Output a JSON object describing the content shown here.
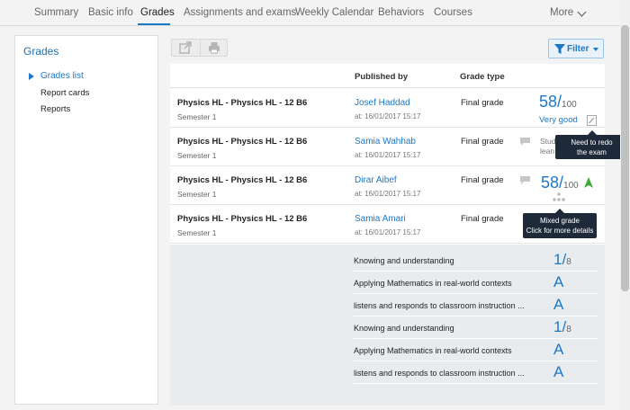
{
  "nav": {
    "tabs": [
      {
        "label": "Summary"
      },
      {
        "label": "Basic info"
      },
      {
        "label": "Grades"
      },
      {
        "label": "Assignments and exams"
      },
      {
        "label": "Weekly Calendar"
      },
      {
        "label": "Behaviors"
      },
      {
        "label": "Courses"
      }
    ],
    "more_label": "More"
  },
  "sidebar": {
    "title": "Grades",
    "items": [
      {
        "label": "Grades list"
      },
      {
        "label": "Report cards"
      },
      {
        "label": "Reports"
      }
    ]
  },
  "toolbar": {
    "filter_label": "Filter",
    "export_icon": "export-icon",
    "print_icon": "print-icon"
  },
  "table": {
    "headers": {
      "published_by": "Published by",
      "grade_type": "Grade type"
    },
    "rows": [
      {
        "course": "Physics HL - Physics HL - 12 B6",
        "semester": "Semester 1",
        "teacher": "Josef Haddad",
        "published": "at: 16/01/2017 15:17",
        "grade_type": "Final grade",
        "score": "58",
        "slash": "/",
        "max": "100",
        "rating": "Very good"
      },
      {
        "course": "Physics HL - Physics HL - 12 B6",
        "semester": "Semester 1",
        "teacher": "Samia Wahhab",
        "published": "at: 16/01/2017 15:17",
        "grade_type": "Final grade",
        "clip_line1": "Stud",
        "clip_line2": "lean"
      },
      {
        "course": "Physics HL - Physics HL - 12 B6",
        "semester": "Semester 1",
        "teacher": "Dirar Aibef",
        "published": "at: 16/01/2017 15:17",
        "grade_type": "Final grade",
        "score": "58",
        "slash": "/",
        "max": "100"
      },
      {
        "course": "Physics HL - Physics HL - 12 B6",
        "semester": "Semester 1",
        "teacher": "Samia Amari",
        "published": "at: 16/01/2017 15:17",
        "grade_type": "Final grade"
      }
    ]
  },
  "criteria": [
    {
      "label": "Knowing and understanding",
      "value": "1",
      "slash": "/",
      "max": "8"
    },
    {
      "label": "Applying Mathematics in real-world contexts",
      "value": "A"
    },
    {
      "label": "listens and responds to classroom instruction ...",
      "value": "A"
    },
    {
      "label": "Knowing and understanding",
      "value": "1",
      "slash": "/",
      "max": "8"
    },
    {
      "label": "Applying Mathematics in real-world contexts",
      "value": "A"
    },
    {
      "label": "listens and responds to classroom instruction ...",
      "value": "A"
    }
  ],
  "tooltips": {
    "redo_line1": "Need to redo",
    "redo_line2": "the exam",
    "mixed_line1": "Mixed grade",
    "mixed_line2": "Click for more details"
  },
  "colors": {
    "accent": "#1b78c8",
    "trend_up": "#3daa3a",
    "tooltip_bg": "#1e2a3a"
  }
}
